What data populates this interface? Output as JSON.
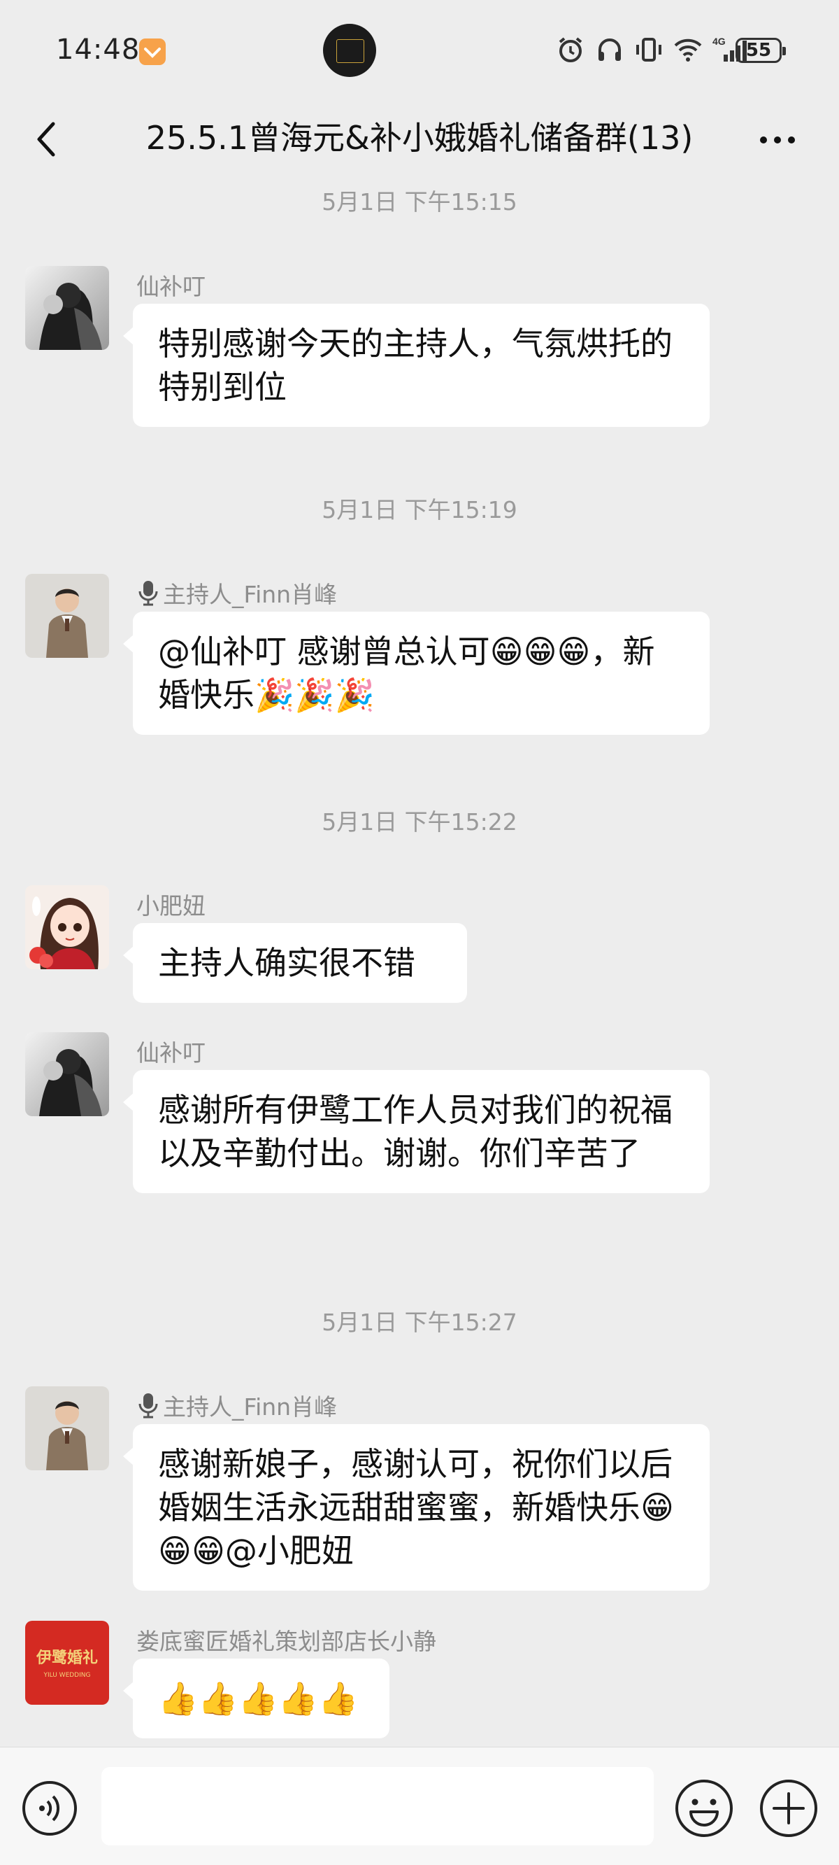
{
  "status_bar": {
    "time": "14:48",
    "network": "4G",
    "battery": "55"
  },
  "header": {
    "title": "25.5.1曾海元&补小娥婚礼储备群(13)"
  },
  "messages": [
    {
      "kind": "timestamp",
      "text": "5月1日 下午15:15"
    },
    {
      "kind": "message",
      "sender": "仙补叮",
      "text": "特别感谢今天的主持人，气氛烘托的特别到位"
    },
    {
      "kind": "timestamp",
      "text": "5月1日 下午15:19"
    },
    {
      "kind": "message",
      "sender": "主持人_Finn肖峰",
      "sender_icon": "microphone-icon",
      "text": "@仙补叮  感谢曾总认可😁😁😁，新婚快乐🎉🎉🎉"
    },
    {
      "kind": "timestamp",
      "text": "5月1日 下午15:22"
    },
    {
      "kind": "message",
      "sender": "小肥妞",
      "text": "主持人确实很不错"
    },
    {
      "kind": "message",
      "sender": "仙补叮",
      "text": "感谢所有伊鹭工作人员对我们的祝福以及辛勤付出。谢谢。你们辛苦了"
    },
    {
      "kind": "timestamp",
      "text": "5月1日 下午15:27"
    },
    {
      "kind": "message",
      "sender": "主持人_Finn肖峰",
      "sender_icon": "microphone-icon",
      "text": "感谢新娘子，感谢认可，祝你们以后婚姻生活永远甜甜蜜蜜，新婚快乐😁😁😁@小肥妞"
    },
    {
      "kind": "message",
      "sender": "娄底蜜匠婚礼策划部店长小静",
      "text": "👍👍👍👍👍"
    }
  ],
  "avatars": {
    "couple": {
      "icon": "couple-photo-avatar"
    },
    "host": {
      "icon": "man-in-suit-avatar"
    },
    "girl": {
      "icon": "cartoon-girl-avatar"
    },
    "logo": {
      "icon": "yilu-wedding-logo-avatar",
      "logo_text": "伊鹭婚礼",
      "logo_subtext": "YILU WEDDING"
    }
  },
  "input_bar": {
    "placeholder": ""
  },
  "colors": {
    "background": "#ededed",
    "bubble": "#ffffff",
    "muted_text": "#8d8d8d",
    "logo_red": "#d42a22"
  }
}
